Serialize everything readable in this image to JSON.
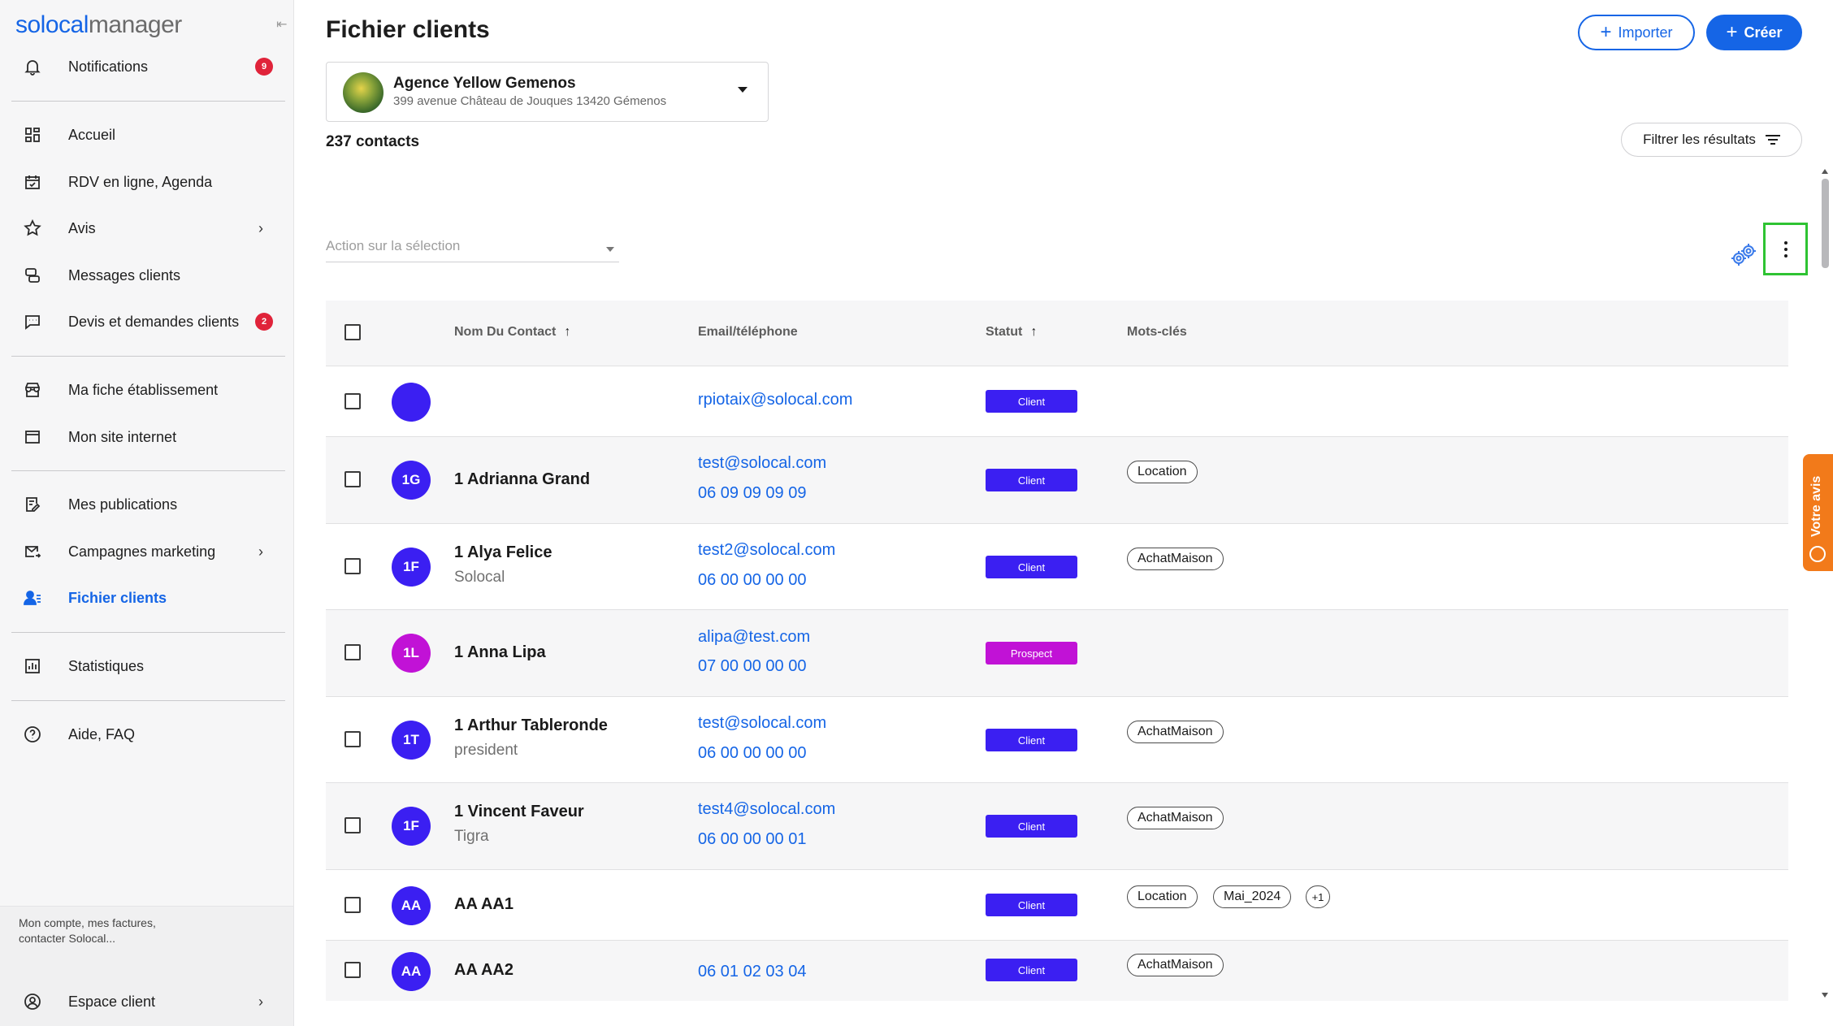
{
  "app": {
    "logo_part1": "solocal",
    "logo_part2": "manager"
  },
  "sidebar": {
    "notifications": {
      "label": "Notifications",
      "badge": "9"
    },
    "items": [
      {
        "label": "Accueil"
      },
      {
        "label": "RDV en ligne, Agenda"
      },
      {
        "label": "Avis"
      },
      {
        "label": "Messages clients"
      },
      {
        "label": "Devis et demandes clients",
        "badge": "2"
      },
      {
        "label": "Ma fiche établissement"
      },
      {
        "label": "Mon site internet"
      },
      {
        "label": "Mes publications"
      },
      {
        "label": "Campagnes marketing"
      },
      {
        "label": "Fichier clients"
      },
      {
        "label": "Statistiques"
      },
      {
        "label": "Aide, FAQ"
      }
    ],
    "account_text": "Mon compte, mes factures, contacter Solocal...",
    "account_item": "Espace client"
  },
  "header": {
    "title": "Fichier clients",
    "import_label": "Importer",
    "create_label": "Créer"
  },
  "agency": {
    "name": "Agence Yellow Gemenos",
    "address": "399 avenue Château de Jouques 13420 Gémenos"
  },
  "contacts_count": "237 contacts",
  "filter_label": "Filtrer les résultats",
  "action_placeholder": "Action sur la sélection",
  "table": {
    "headers": {
      "name": "Nom Du Contact",
      "contact": "Email/téléphone",
      "status": "Statut",
      "keywords": "Mots-clés"
    },
    "rows": [
      {
        "initials": "",
        "name": "",
        "sub": "",
        "email": "rpiotaix@solocal.com",
        "phone": "",
        "status": "Client",
        "tags": []
      },
      {
        "initials": "1G",
        "name": "1 Adrianna Grand",
        "sub": "",
        "email": "test@solocal.com",
        "phone": "06 09 09 09 09",
        "status": "Client",
        "tags": [
          "Location"
        ]
      },
      {
        "initials": "1F",
        "name": "1 Alya Felice",
        "sub": "Solocal",
        "email": "test2@solocal.com",
        "phone": "06 00 00 00 00",
        "status": "Client",
        "tags": [
          "AchatMaison"
        ]
      },
      {
        "initials": "1L",
        "name": "1 Anna Lipa",
        "sub": "",
        "email": "alipa@test.com",
        "phone": "07 00 00 00 00",
        "status": "Prospect",
        "tags": []
      },
      {
        "initials": "1T",
        "name": "1 Arthur Tableronde",
        "sub": "president",
        "email": "test@solocal.com",
        "phone": "06 00 00 00 00",
        "status": "Client",
        "tags": [
          "AchatMaison"
        ]
      },
      {
        "initials": "1F",
        "name": "1 Vincent Faveur",
        "sub": "Tigra",
        "email": "test4@solocal.com",
        "phone": "06 00 00 00 01",
        "status": "Client",
        "tags": [
          "AchatMaison"
        ]
      },
      {
        "initials": "AA",
        "name": "AA AA1",
        "sub": "",
        "email": "",
        "phone": "",
        "status": "Client",
        "tags": [
          "Location",
          "Mai_2024",
          "+1"
        ]
      },
      {
        "initials": "AA",
        "name": "AA AA2",
        "sub": "",
        "email": "",
        "phone": "06 01 02 03 04",
        "status": "Client",
        "tags": [
          "AchatMaison"
        ]
      }
    ]
  },
  "feedback_label": "Votre avis",
  "colors": {
    "accent": "#1565e6",
    "client": "#3b1ff2",
    "prospect": "#c112d6",
    "badge": "#e0233a",
    "feedback": "#f27a1a"
  }
}
